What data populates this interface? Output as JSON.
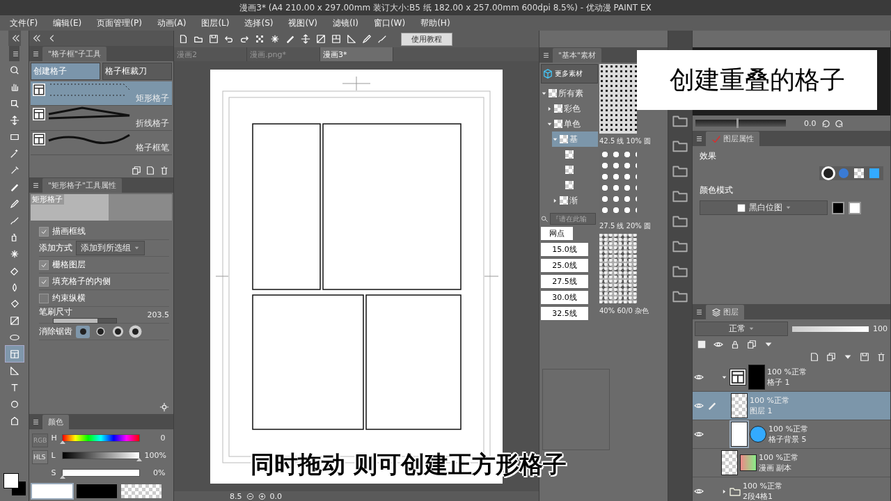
{
  "window": {
    "title": "漫画3* (A4 210.00 x 297.00mm 装订大小:B5 纸 182.00 x 257.00mm 600dpi 8.5%) - 优动漫 PAINT EX"
  },
  "menu": [
    "文件(F)",
    "编辑(E)",
    "页面管理(P)",
    "动画(A)",
    "图层(L)",
    "选择(S)",
    "视图(V)",
    "滤镜(I)",
    "窗口(W)",
    "帮助(H)"
  ],
  "toolbar": {
    "tutorial_button": "使用教程"
  },
  "tools": [
    {
      "kind": "zoom",
      "selected": false
    },
    {
      "kind": "hand",
      "selected": false
    },
    {
      "kind": "move",
      "selected": false
    },
    {
      "kind": "operate",
      "selected": false
    },
    {
      "kind": "marquee",
      "selected": false
    },
    {
      "kind": "wand",
      "selected": false
    },
    {
      "kind": "eyedropper",
      "selected": false
    },
    {
      "kind": "pen",
      "selected": false
    },
    {
      "kind": "pencil",
      "selected": false
    },
    {
      "kind": "brush",
      "selected": false
    },
    {
      "kind": "spray",
      "selected": false
    },
    {
      "kind": "blend",
      "selected": false
    },
    {
      "kind": "eraser",
      "selected": false
    },
    {
      "kind": "fill",
      "selected": false
    },
    {
      "kind": "bucket",
      "selected": false
    },
    {
      "kind": "gradient",
      "selected": false
    },
    {
      "kind": "ellipse",
      "selected": false
    },
    {
      "kind": "frame",
      "selected": true
    },
    {
      "kind": "ruler",
      "selected": false
    },
    {
      "kind": "text",
      "selected": false
    },
    {
      "kind": "balloon",
      "selected": false
    },
    {
      "kind": "correct",
      "selected": false
    }
  ],
  "subtool_panel": {
    "title": "\"格子框\"子工具",
    "tabs": [
      {
        "label": "创建格子",
        "selected": true
      },
      {
        "label": "格子框裁刀",
        "selected": false
      }
    ],
    "items": [
      {
        "label": "矩形格子",
        "kind": "dotted",
        "selected": true
      },
      {
        "label": "折线格子",
        "kind": "polyline",
        "selected": false
      },
      {
        "label": "格子框笔",
        "kind": "wave",
        "selected": false
      }
    ]
  },
  "tool_property": {
    "title": "\"矩形格子\"工具属性",
    "preview_label": "矩形格子",
    "rows": [
      {
        "kind": "checkbox",
        "label": "描画框线",
        "checked": true
      },
      {
        "kind": "select",
        "label": "添加方式",
        "value": "添加到所选组"
      },
      {
        "kind": "checkbox",
        "label": "栅格图层",
        "checked": true
      },
      {
        "kind": "checkbox",
        "label": "填充格子的内侧",
        "checked": true
      },
      {
        "kind": "checkbox",
        "label": "约束纵横",
        "checked": false
      },
      {
        "kind": "slider",
        "label": "笔刷尺寸",
        "value": "203.5",
        "level": 0.7
      },
      {
        "kind": "antialias",
        "label": "消除锯齿",
        "options": [
          {
            "selected": true
          },
          {
            "selected": false
          },
          {
            "selected": false
          },
          {
            "selected": false
          }
        ]
      }
    ]
  },
  "color_panel": {
    "tab": "颜色",
    "modes": [
      {
        "label": "RGB",
        "selected": false
      },
      {
        "label": "HLS",
        "selected": true
      }
    ],
    "sliders": [
      {
        "label": "H",
        "value": "0",
        "level": 0,
        "kind": "hue"
      },
      {
        "label": "L",
        "value": "100%",
        "level": 1,
        "kind": "lightness"
      },
      {
        "label": "S",
        "value": "0%",
        "level": 0,
        "kind": "saturation"
      }
    ]
  },
  "document_tabs": [
    {
      "label": "漫画2",
      "selected": false
    },
    {
      "label": "漫画.png*",
      "selected": false
    },
    {
      "label": "漫画3*",
      "selected": true
    }
  ],
  "status_bar": {
    "zoom": "8.5",
    "angle": "0.0"
  },
  "material_panel": {
    "title": "\"基本\"素材",
    "more_button": "更多素材",
    "tree": [
      {
        "label": "所有素",
        "expanded": true,
        "selected": false,
        "children": [
          {
            "label": "彩色",
            "expanded": false,
            "selected": false
          },
          {
            "label": "单色",
            "expanded": true,
            "selected": false,
            "children": [
              {
                "label": "基",
                "expanded": true,
                "selected": true,
                "children": [
                  {
                    "kind": "tone"
                  },
                  {
                    "kind": "tone"
                  },
                  {
                    "kind": "tone"
                  }
                ]
              },
              {
                "label": "渐",
                "expanded": false,
                "selected": false
              }
            ]
          }
        ]
      }
    ],
    "search": {
      "placeholder": "『请在此输"
    },
    "tags": [
      {
        "label": "网点",
        "kind": "category"
      },
      {
        "label": "15.0线",
        "kind": "tag"
      },
      {
        "label": "25.0线",
        "kind": "tag"
      },
      {
        "label": "27.5线",
        "kind": "tag"
      },
      {
        "label": "30.0线",
        "kind": "tag"
      },
      {
        "label": "32.5线",
        "kind": "tag"
      }
    ],
    "thumbnails": [
      {
        "label": "42.5 线 10% 圆",
        "kind": "small-dots"
      },
      {
        "label": "27.5 线 20% 圆",
        "kind": "large-dots"
      },
      {
        "label": "40% 60/0 杂色",
        "kind": "noise"
      }
    ]
  },
  "navigator": {
    "angle": "0.0",
    "zoom_slider": {
      "level": 0.45
    }
  },
  "layer_property": {
    "tab": "图层属性",
    "effect_label": "效果",
    "color_mode_label": "颜色模式",
    "color_mode": "黑白位图"
  },
  "layer_panel": {
    "tab": "图层",
    "blend_mode": "正常",
    "opacity": {
      "value": "100",
      "level": 1
    },
    "layers": [
      {
        "mode": "100 %正常",
        "name": "格子 1",
        "kind": "frame",
        "visible": true,
        "expanded": true,
        "selected": false,
        "editing": false,
        "children": [
          {
            "mode": "100 %正常",
            "name": "图层 1",
            "kind": "raster",
            "visible": true,
            "selected": true,
            "editing": true
          },
          {
            "mode": "100 %正常",
            "name": "格子背景 5",
            "kind": "fill",
            "visible": true,
            "selected": false,
            "editing": false
          }
        ]
      },
      {
        "mode": "100 %正常",
        "name": "漫画 副本",
        "kind": "image",
        "visible": false,
        "selected": false,
        "editing": false
      },
      {
        "mode": "100 %正常",
        "name": "2段4格1",
        "kind": "folder",
        "visible": true,
        "expanded": false,
        "selected": false,
        "editing": false
      }
    ]
  },
  "captions": {
    "heading": "创建重叠的格子",
    "subtitle": "同时拖动 则可创建正方形格子"
  }
}
